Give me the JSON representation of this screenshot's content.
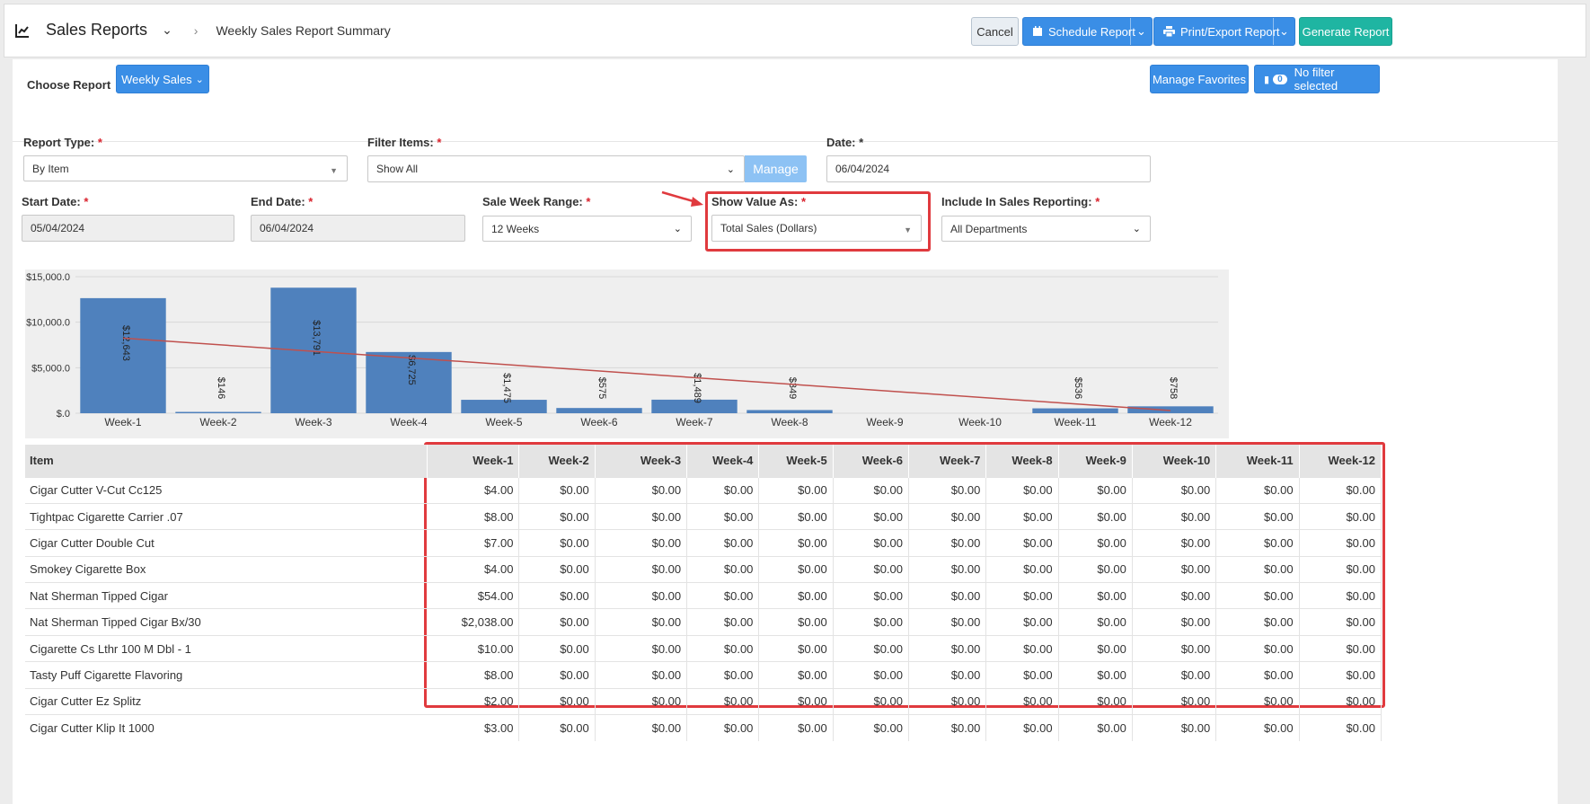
{
  "header": {
    "title": "Sales Reports",
    "breadcrumb": "Weekly Sales Report Summary",
    "cancel_label": "Cancel",
    "schedule_label": "Schedule Report",
    "print_label": "Print/Export Report",
    "generate_label": "Generate Report"
  },
  "subheader": {
    "choose_report_label": "Choose Report",
    "report_button": "Weekly Sales",
    "manage_favorites": "Manage Favorites",
    "filter_count": "0",
    "filter_label": "No filter selected"
  },
  "form": {
    "report_type_label": "Report Type:",
    "report_type_value": "By Item",
    "filter_items_label": "Filter Items:",
    "filter_items_value": "Show All",
    "manage_label": "Manage",
    "date_label": "Date: *",
    "date_value": "06/04/2024",
    "start_date_label": "Start Date:",
    "start_date_value": "05/04/2024",
    "end_date_label": "End Date:",
    "end_date_value": "06/04/2024",
    "week_range_label": "Sale Week Range:",
    "week_range_value": "12 Weeks",
    "show_value_label": "Show Value As:",
    "show_value_value": "Total Sales (Dollars)",
    "include_label": "Include In Sales Reporting:",
    "include_value": "All Departments",
    "required_mark": "*"
  },
  "colors": {
    "accent": "#3a8ee6",
    "teal": "#1fb5a2",
    "bar": "#4f81bd",
    "trend": "#c0504d",
    "highlight": "#e03a3e"
  },
  "chart_data": {
    "type": "bar",
    "categories": [
      "Week-1",
      "Week-2",
      "Week-3",
      "Week-4",
      "Week-5",
      "Week-6",
      "Week-7",
      "Week-8",
      "Week-9",
      "Week-10",
      "Week-11",
      "Week-12"
    ],
    "values": [
      12643,
      146,
      13791,
      6725,
      1475,
      575,
      1489,
      349,
      0,
      0,
      536,
      758
    ],
    "data_labels": [
      "$12,643",
      "$146",
      "$13,791",
      "$6,725",
      "$1,475",
      "$575",
      "$1,489",
      "$349",
      "",
      "",
      "$536",
      "$758"
    ],
    "y_ticks": [
      "$.0",
      "$5,000.0",
      "$10,000.0",
      "$15,000.0"
    ],
    "y_tick_values": [
      0,
      5000,
      10000,
      15000
    ],
    "ylim": [
      0,
      15000
    ],
    "trendline": {
      "start": 8250,
      "end": 300
    },
    "grid": true
  },
  "table": {
    "item_header": "Item",
    "week_headers": [
      "Week-1",
      "Week-2",
      "Week-3",
      "Week-4",
      "Week-5",
      "Week-6",
      "Week-7",
      "Week-8",
      "Week-9",
      "Week-10",
      "Week-11",
      "Week-12"
    ],
    "rows": [
      {
        "item": "Cigar Cutter V-Cut Cc125",
        "week1": "$4.00"
      },
      {
        "item": "Tightpac Cigarette Carrier .07",
        "week1": "$8.00"
      },
      {
        "item": "Cigar Cutter Double Cut",
        "week1": "$7.00"
      },
      {
        "item": "Smokey Cigarette Box",
        "week1": "$4.00"
      },
      {
        "item": "Nat Sherman Tipped Cigar",
        "week1": "$54.00"
      },
      {
        "item": "Nat Sherman Tipped Cigar Bx/30",
        "week1": "$2,038.00"
      },
      {
        "item": "Cigarette Cs Lthr 100 M Dbl - 1",
        "week1": "$10.00"
      },
      {
        "item": "Tasty Puff Cigarette Flavoring",
        "week1": "$8.00"
      },
      {
        "item": "Cigar Cutter Ez Splitz",
        "week1": "$2.00"
      },
      {
        "item": "Cigar Cutter Klip It 1000",
        "week1": "$3.00"
      }
    ],
    "zero_value": "$0.00"
  }
}
